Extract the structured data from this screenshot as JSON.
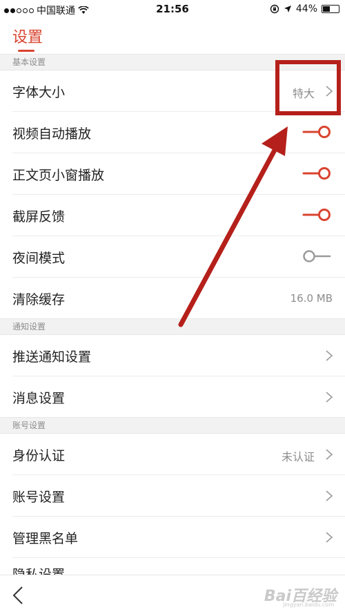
{
  "status_bar": {
    "carrier": "中国联通",
    "time": "21:56",
    "battery": "44%",
    "battery_level": 0.44,
    "icons": [
      "signal-dots-icon",
      "wifi-icon",
      "lock-rotation-icon",
      "location-arrow-icon",
      "battery-icon"
    ]
  },
  "header": {
    "title": "设置"
  },
  "sections": [
    {
      "title": "基本设置",
      "rows": [
        {
          "label": "字体大小",
          "value": "特大",
          "control": "chevron"
        },
        {
          "label": "视频自动播放",
          "toggle": true
        },
        {
          "label": "正文页小窗播放",
          "toggle": true
        },
        {
          "label": "截屏反馈",
          "toggle": true
        },
        {
          "label": "夜间模式",
          "toggle": false
        },
        {
          "label": "清除缓存",
          "value": "16.0 MB"
        }
      ]
    },
    {
      "title": "通知设置",
      "rows": [
        {
          "label": "推送通知设置",
          "control": "chevron"
        },
        {
          "label": "消息设置",
          "control": "chevron"
        }
      ]
    },
    {
      "title": "账号设置",
      "rows": [
        {
          "label": "身份认证",
          "value": "未认证",
          "control": "chevron"
        },
        {
          "label": "账号设置",
          "control": "chevron"
        },
        {
          "label": "管理黑名单",
          "control": "chevron"
        },
        {
          "label": "隐私设置"
        }
      ]
    }
  ],
  "bottom_bar": {
    "watermark": "Bai百经验",
    "watermark_sub": "jingyan.baidu.com"
  },
  "colors": {
    "accent": "#d9432f",
    "toggle_on": "#d9432f",
    "toggle_off": "#9a9a9a",
    "annotation": "#b5201b",
    "section_bg": "#f2f2f2"
  }
}
